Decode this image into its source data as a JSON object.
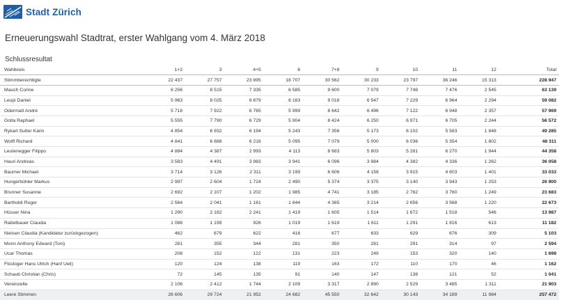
{
  "brand": {
    "name": "Stadt Zürich"
  },
  "page": {
    "title": "Erneuerungswahl Stadtrat, erster Wahlgang vom 4. März 2018",
    "subtitle": "Schlussresultat"
  },
  "table": {
    "columns": [
      "Wahlkreis",
      "1+2",
      "3",
      "4+5",
      "6",
      "7+8",
      "9",
      "10",
      "11",
      "12",
      "Total"
    ],
    "rows": [
      [
        "Stimmberechtigte",
        "22 437",
        "27 757",
        "23 895",
        "18 707",
        "30 562",
        "30 233",
        "23 797",
        "36 246",
        "15 313",
        "228 947"
      ],
      [
        "Mauch Corine",
        "6 256",
        "8 515",
        "7 335",
        "6 585",
        "9 600",
        "7 079",
        "7 748",
        "7 476",
        "2 545",
        "63 139"
      ],
      [
        "Leupi Daniel",
        "5 963",
        "8 025",
        "6 879",
        "6 163",
        "9 018",
        "6 547",
        "7 229",
        "6 964",
        "2 294",
        "59 082"
      ],
      [
        "Odermatt André",
        "5 718",
        "7 922",
        "6 765",
        "5 999",
        "8 642",
        "6 496",
        "7 122",
        "6 948",
        "2 357",
        "57 969"
      ],
      [
        "Golta Raphael",
        "5 555",
        "7 790",
        "6 729",
        "5 904",
        "8 424",
        "6 250",
        "6 971",
        "6 705",
        "2 244",
        "56 572"
      ],
      [
        "Rykart Sutter Karin",
        "4 854",
        "6 932",
        "6 194",
        "5 243",
        "7 356",
        "5 173",
        "6 102",
        "5 583",
        "1 848",
        "49 285"
      ],
      [
        "Wolff Richard",
        "4 841",
        "6 888",
        "6 216",
        "5 095",
        "7 079",
        "5 000",
        "6 036",
        "5 354",
        "1 802",
        "48 311"
      ],
      [
        "Leutenegger Filippo",
        "4 884",
        "4 387",
        "2 993",
        "4 113",
        "8 683",
        "5 803",
        "5 281",
        "6 270",
        "1 944",
        "44 358"
      ],
      [
        "Hauri Andreas",
        "3 583",
        "4 491",
        "3 983",
        "3 941",
        "6 096",
        "3 984",
        "4 382",
        "4 336",
        "1 262",
        "36 058"
      ],
      [
        "Baumer Michael",
        "3 714",
        "3 126",
        "2 311",
        "3 199",
        "6 606",
        "4 158",
        "3 915",
        "4 603",
        "1 401",
        "33 033"
      ],
      [
        "Hungerbühler Markus",
        "2 997",
        "2 604",
        "1 724",
        "2 490",
        "5 374",
        "3 375",
        "3 140",
        "3 943",
        "1 253",
        "26 900"
      ],
      [
        "Brunner Susanne",
        "2 692",
        "2 107",
        "1 202",
        "1 985",
        "4 741",
        "3 185",
        "2 762",
        "3 760",
        "1 249",
        "23 683"
      ],
      [
        "Bartholdi Roger",
        "2 564",
        "2 041",
        "1 181",
        "1 844",
        "4 385",
        "3 214",
        "2 656",
        "3 568",
        "1 220",
        "22 673"
      ],
      [
        "Hüsser Nina",
        "1 290",
        "2 182",
        "2 241",
        "1 419",
        "1 605",
        "1 514",
        "1 672",
        "1 518",
        "546",
        "13 987"
      ],
      [
        "Rabelbauer Claudia",
        "1 088",
        "1 199",
        "926",
        "1 019",
        "1 619",
        "1 611",
        "1 291",
        "1 816",
        "613",
        "11 182"
      ],
      [
        "Nielsen Claudia (Kandidatur zurückgezogen)",
        "462",
        "679",
        "622",
        "416",
        "677",
        "633",
        "629",
        "676",
        "309",
        "5 103"
      ],
      [
        "Monn Anthony Edward (Toni)",
        "281",
        "355",
        "344",
        "281",
        "350",
        "281",
        "291",
        "314",
        "97",
        "2 594"
      ],
      [
        "Ucar Thomas",
        "208",
        "152",
        "122",
        "131",
        "223",
        "249",
        "153",
        "320",
        "140",
        "1 698"
      ],
      [
        "Flückiger Hans Ulrich (Hanf Ueli)",
        "120",
        "124",
        "138",
        "119",
        "163",
        "172",
        "110",
        "170",
        "46",
        "1 162"
      ],
      [
        "Schaub Christian (Chris)",
        "72",
        "145",
        "135",
        "91",
        "140",
        "147",
        "138",
        "121",
        "52",
        "1 041"
      ],
      [
        "Vereinzelte",
        "2 106",
        "2 412",
        "1 744",
        "2 109",
        "3 317",
        "2 890",
        "2 529",
        "3 485",
        "1 311",
        "21 903"
      ],
      [
        "Leere Stimmen",
        "26 606",
        "29 724",
        "21 952",
        "24 682",
        "45 550",
        "32 642",
        "30 143",
        "34 189",
        "11 984",
        "257 472"
      ]
    ]
  },
  "icons": {
    "logo": "stadt-zuerich-logo-icon"
  },
  "colors": {
    "brand": "#1f5fa8",
    "header_rule": "#bbbbbb",
    "row_rule": "#e4e4e4",
    "last_row_bg": "#eef1f4"
  }
}
